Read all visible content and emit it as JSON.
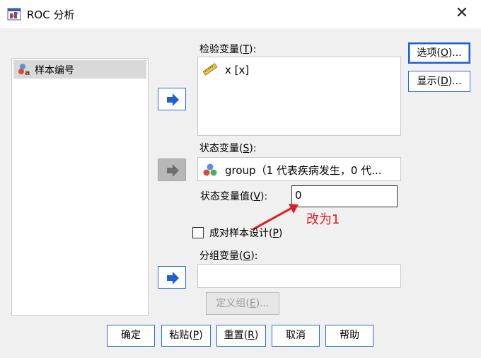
{
  "window": {
    "title": "ROC 分析",
    "close_glyph": "✕"
  },
  "source_list": {
    "items": [
      {
        "label": "样本编号"
      }
    ]
  },
  "test_variable": {
    "label_prefix": "检验变量(",
    "mnemonic": "T",
    "label_suffix": "):",
    "items": [
      {
        "label": "x [x]"
      }
    ]
  },
  "state_variable": {
    "label_prefix": "状态变量(",
    "mnemonic": "S",
    "label_suffix": "):",
    "value": "group（1 代表疾病发生，0 代..."
  },
  "state_value": {
    "label_prefix": "状态变量值(",
    "mnemonic": "V",
    "label_suffix": "):",
    "value": "0"
  },
  "paired_design": {
    "label_prefix": "成对样本设计(",
    "mnemonic": "P",
    "label_suffix": ")",
    "checked": false
  },
  "group_variable": {
    "label_prefix": "分组变量(",
    "mnemonic": "G",
    "label_suffix": "):",
    "value": ""
  },
  "define_groups": {
    "label_prefix": "定义组(",
    "mnemonic": "E",
    "label_suffix": ")..."
  },
  "side_buttons": {
    "options": {
      "prefix": "选项(",
      "mnemonic": "O",
      "suffix": ")..."
    },
    "display": {
      "prefix": "显示(",
      "mnemonic": "D",
      "suffix": ")..."
    }
  },
  "footer": {
    "ok": "确定",
    "paste": {
      "prefix": "粘贴(",
      "mnemonic": "P",
      "suffix": ")"
    },
    "reset": {
      "prefix": "重置(",
      "mnemonic": "R",
      "suffix": ")"
    },
    "cancel": "取消",
    "help": "帮助"
  },
  "annotation": {
    "text": "改为1",
    "color": "#e02020"
  },
  "colors": {
    "accent": "#2a6fd6",
    "selection": "#d9d9d9"
  }
}
